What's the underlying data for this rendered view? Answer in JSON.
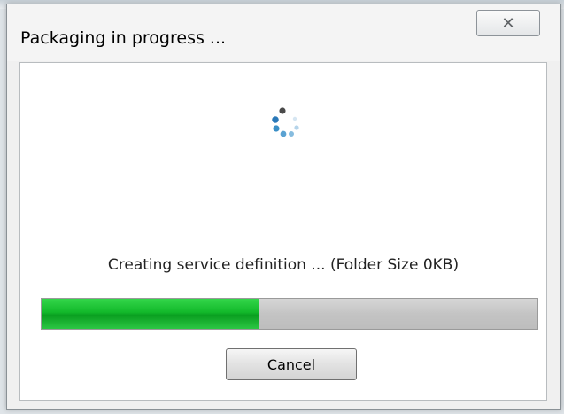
{
  "window": {
    "title": "Packaging in progress ..."
  },
  "icons": {
    "close": "close-icon",
    "spinner": "loading-spinner-icon"
  },
  "status": {
    "text": "Creating service definition ... (Folder Size 0KB)"
  },
  "progress": {
    "fraction": 0.44
  },
  "buttons": {
    "cancel_label": "Cancel"
  },
  "colors": {
    "progress_fill": "#12b82a",
    "progress_track": "#c8c8c8"
  }
}
